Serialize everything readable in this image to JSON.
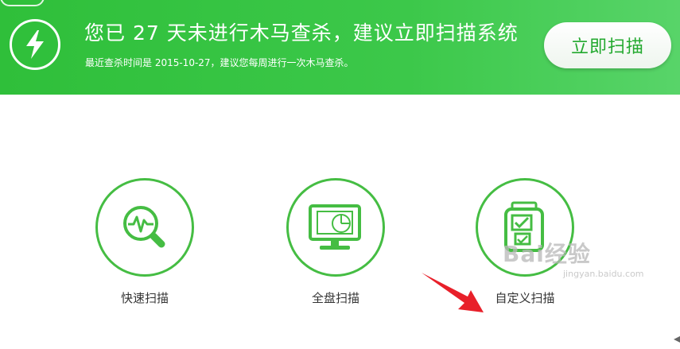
{
  "banner": {
    "headline": "您已 27 天未进行木马查杀，建议立即扫描系统",
    "subline": "最近查杀时间是 2015-10-27，建议您每周进行一次木马查杀。",
    "scan_button": "立即扫描",
    "icon": "lightning-bolt-icon"
  },
  "options": {
    "quick": {
      "label": "快速扫描",
      "icon": "magnifier-pulse-icon"
    },
    "full": {
      "label": "全盘扫描",
      "icon": "monitor-pie-icon"
    },
    "custom": {
      "label": "自定义扫描",
      "icon": "clipboard-check-icon"
    }
  },
  "watermark": {
    "brand": "Bai经验",
    "url": "jingyan.baidu.com"
  },
  "colors": {
    "banner_green": "#3cc84a",
    "accent_green": "#45bd43",
    "button_text": "#23a92f",
    "arrow_red": "#e8202a"
  }
}
